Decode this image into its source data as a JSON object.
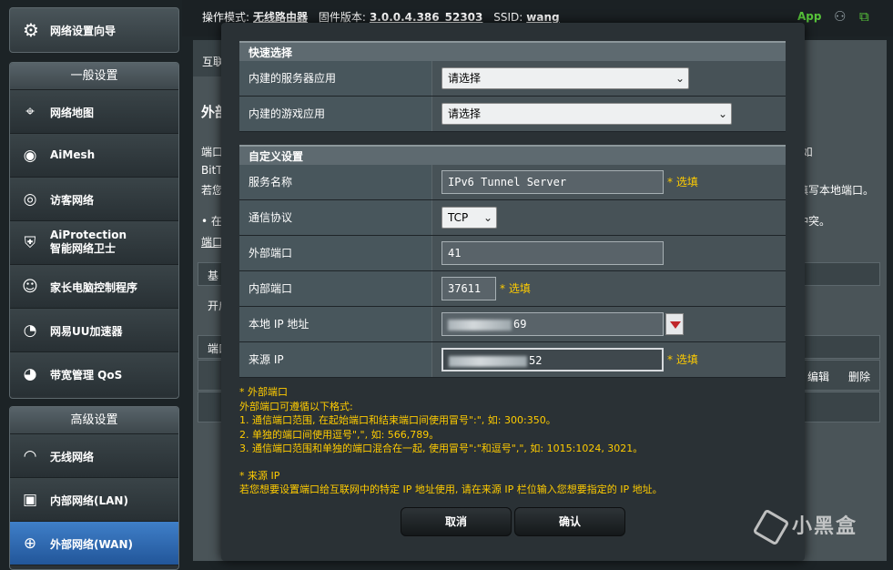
{
  "topbar": {
    "mode_label": "操作模式:",
    "mode_value": "无线路由器",
    "firmware_label": "固件版本:",
    "firmware_value": "3.0.0.4.386_52303",
    "ssid_label": "SSID:",
    "ssid_value": "wang",
    "app_label": "App"
  },
  "sidebar": {
    "wizard": "网络设置向导",
    "general_header": "一般设置",
    "general_items": [
      {
        "label": "网络地图",
        "icon": "map-pin-icon"
      },
      {
        "label": "AiMesh",
        "icon": "mesh-icon"
      },
      {
        "label": "访客网络",
        "icon": "globe-icon"
      },
      {
        "label": "AiProtection",
        "sublabel": "智能网络卫士",
        "icon": "shield-icon"
      },
      {
        "label": "家长电脑控制程序",
        "icon": "family-icon"
      },
      {
        "label": "网易UU加速器",
        "icon": "speedometer-icon"
      },
      {
        "label": "带宽管理 QoS",
        "icon": "gauge-icon"
      }
    ],
    "advanced_header": "高级设置",
    "advanced_items": [
      {
        "label": "无线网络",
        "icon": "wifi-icon"
      },
      {
        "label": "内部网络(LAN)",
        "icon": "lan-icon"
      },
      {
        "label": "外部网络(WAN)",
        "icon": "wan-globe-icon",
        "active": true
      }
    ]
  },
  "background": {
    "tab": "互联",
    "title": "外部",
    "line1": "端口",
    "line1_right": "(如",
    "line2": "BitT",
    "line3": "若您",
    "line3_right": "填写本地端口。",
    "bullet": "• 在",
    "bullet_right": "冲突。",
    "link": "端口",
    "basic_hdr": "基",
    "open": "开启",
    "list_hdr": "端口",
    "edit": "编辑",
    "delete": "删除"
  },
  "modal": {
    "quick_header": "快速选择",
    "builtin_server_label": "内建的服务器应用",
    "builtin_server_value": "请选择",
    "builtin_game_label": "内建的游戏应用",
    "builtin_game_value": "请选择",
    "custom_header": "自定义设置",
    "service_name_label": "服务名称",
    "service_name_value": "IPv6 Tunnel Server",
    "optional": "* 选填",
    "protocol_label": "通信协议",
    "protocol_value": "TCP",
    "external_port_label": "外部端口",
    "external_port_value": "41",
    "internal_port_label": "内部端口",
    "internal_port_value": "37611",
    "local_ip_label": "本地 IP 地址",
    "local_ip_suffix": "69",
    "source_ip_label": "来源 IP",
    "source_ip_suffix": "52",
    "notes": {
      "ext_title": "* 外部端口",
      "ext_intro": "外部端口可遵循以下格式:",
      "ext_1": "1. 通信端口范围, 在起始端口和结束端口间使用冒号\":\", 如: 300:350。",
      "ext_2": "2. 单独的端口间使用逗号\",\", 如: 566,789。",
      "ext_3": "3. 通信端口范围和单独的端口混合在一起, 使用冒号\":\"和逗号\",\", 如: 1015:1024, 3021。",
      "src_title": "* 来源 IP",
      "src_desc": "若您想要设置端口给互联网中的特定 IP 地址使用, 请在来源 IP 栏位输入您想要指定的 IP 地址。"
    },
    "cancel": "取消",
    "confirm": "确认"
  },
  "watermark": "小黑盒"
}
